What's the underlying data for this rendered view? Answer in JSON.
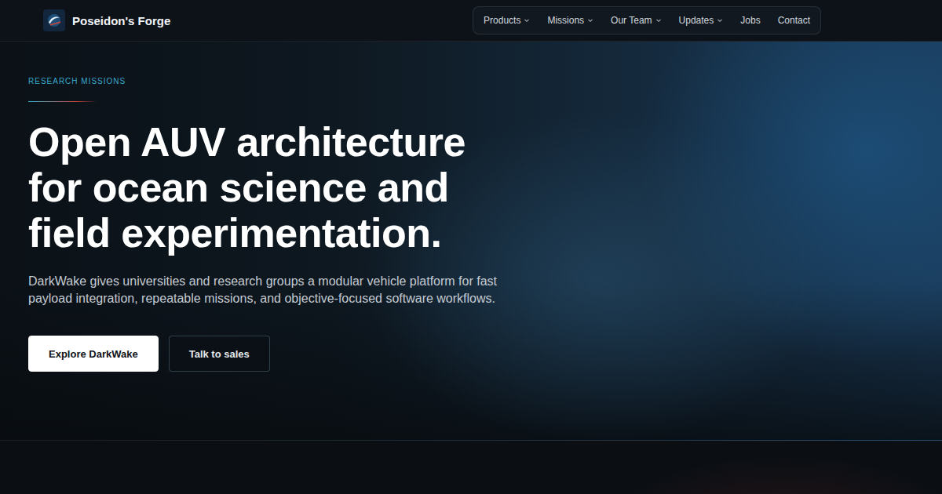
{
  "header": {
    "brand": "Poseidon's Forge",
    "nav": [
      {
        "label": "Products",
        "dropdown": true
      },
      {
        "label": "Missions",
        "dropdown": true
      },
      {
        "label": "Our Team",
        "dropdown": true
      },
      {
        "label": "Updates",
        "dropdown": true
      },
      {
        "label": "Jobs",
        "dropdown": false
      },
      {
        "label": "Contact",
        "dropdown": false
      }
    ]
  },
  "hero": {
    "eyebrow": "RESEARCH MISSIONS",
    "title_lines": [
      "Open AUV architecture",
      "for ocean science and",
      "field experimentation."
    ],
    "description": "DarkWake gives universities and research groups a modular vehicle platform for fast payload integration, repeatable missions, and objective-focused software workflows.",
    "buttons": [
      {
        "label": "Explore DarkWake",
        "kind": "primary"
      },
      {
        "label": "Talk to sales",
        "kind": "secondary"
      }
    ]
  }
}
